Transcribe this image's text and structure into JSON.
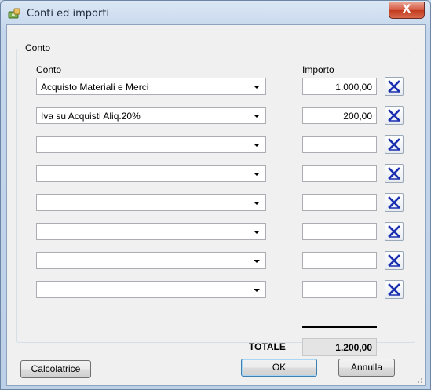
{
  "window": {
    "title": "Conti ed importi",
    "close_glyph": "X"
  },
  "group": {
    "label": "Conto"
  },
  "columns": {
    "account": "Conto",
    "amount": "Importo"
  },
  "rows": [
    {
      "account": "Acquisto Materiali e Merci",
      "amount": "1.000,00"
    },
    {
      "account": "Iva su Acquisti Aliq.20%",
      "amount": "200,00"
    },
    {
      "account": "",
      "amount": ""
    },
    {
      "account": "",
      "amount": ""
    },
    {
      "account": "",
      "amount": ""
    },
    {
      "account": "",
      "amount": ""
    },
    {
      "account": "",
      "amount": ""
    },
    {
      "account": "",
      "amount": ""
    }
  ],
  "total": {
    "label": "TOTALE",
    "value": "1.200,00"
  },
  "buttons": {
    "calculator": "Calcolatrice",
    "ok": "OK",
    "cancel": "Annulla"
  },
  "colors": {
    "delete_icon": "#1a2fb0",
    "title_text": "#1e2b3c",
    "close_button": "#c8462c"
  },
  "icons": {
    "app": "money-icon",
    "delete": "delete-x-icon",
    "dropdown": "chevron-down-icon"
  }
}
